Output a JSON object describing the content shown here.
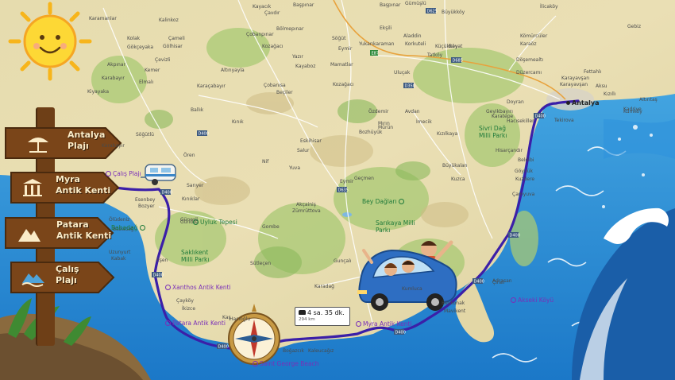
{
  "map": {
    "towns": [
      "Karamanlar",
      "Kalinkoz",
      "Kayacık",
      "Çavdır",
      "Başpınar",
      "Başpınar",
      "Gümüşlü",
      "Büyükköy",
      "İlicaköy",
      "Gebiz",
      "Kolak",
      "Çameli",
      "Gölhisar",
      "Bölmepınar",
      "Söğüt",
      "Yukarıkaraman",
      "Aladdin",
      "Küçükköy",
      "Gökçeyaka",
      "Çevizli",
      "Kozağacı",
      "Yazır",
      "Korkuteli",
      "Bayat",
      "Kömürcüler",
      "Akpınar",
      "Kemer",
      "Eymir",
      "Karaöz",
      "Mamatlar",
      "Tatköy",
      "Ekşili",
      "Karabayır",
      "Elmalı",
      "Altınyayla",
      "Kayaboz",
      "Uluçak",
      "Döşemealtı",
      "Düzercamı",
      "Fettahlı",
      "Karaçabayır",
      "Çobanısa",
      "Beçiler",
      "Kozağacı",
      "Aksu",
      "Karayavşan",
      "Karayavşan",
      "Kızıllı",
      "Kınık",
      "Karabayır",
      "Kiyayaka",
      "Altıntaş",
      "Kumköy",
      "Çobanpınar",
      "Ballık",
      "Özdemir",
      "Avdan",
      "Doyran",
      "Geyikbayırı",
      "Mırın",
      "Mürün",
      "Bozhüyük",
      "Kadriye",
      "Karatepe",
      "Hacısekiller",
      "Nif",
      "İmecik",
      "Kızılkaya",
      "Söğütlü",
      "Eskihisar",
      "Ören",
      "Salur",
      "Hisarçandır",
      "Yuva",
      "Büyükalan",
      "Sarıyer",
      "Eymir",
      "Geçmen",
      "Kuzca",
      "Kuzdere",
      "Çamyuva",
      "Beldibi",
      "Göynük",
      "Esenbey",
      "Bozyer",
      "Kınıklar",
      "Gündüz",
      "Akçainiş",
      "Zümrüttova",
      "Ölüdeniz",
      "Babadağ",
      "Güneşli",
      "Gombe",
      "Uzunyurt",
      "Kabak",
      "Eşen",
      "Sütleçen",
      "Gunçalı",
      "Adrasan",
      "Çayköy",
      "İkizce",
      "Karadağ",
      "Kumluca",
      "Beykonak",
      "Mavikent",
      "Kaş",
      "Hacıoğlu",
      "Boğazcık",
      "Kaleucağız",
      "Çıralı",
      "Tekirova"
    ],
    "pois": [
      {
        "name": "Çalış Plajı",
        "kind": "purple"
      },
      {
        "name": "Xanthos Antik Kenti",
        "kind": "purple"
      },
      {
        "name": "Patara Antik Kenti",
        "kind": "purple"
      },
      {
        "name": "Myra Antik Kenti",
        "kind": "purple"
      },
      {
        "name": "Saint George Beach",
        "kind": "purple"
      },
      {
        "name": "Akseki Köyü",
        "kind": "purple"
      },
      {
        "name": "Uyluk Tepesi",
        "kind": "green"
      },
      {
        "name": "Bey Dağları",
        "kind": "green"
      },
      {
        "name": "Saklıkent Milli Parkı",
        "kind": "green"
      },
      {
        "name": "Sarıkaya Milli Parkı",
        "kind": "green"
      },
      {
        "name": "Sivri Dağ Milli Parkı",
        "kind": "green"
      },
      {
        "name": "Babadağ",
        "kind": "green"
      }
    ],
    "city": "Antalya",
    "road_badges": [
      "D400",
      "D350",
      "D635",
      "D625",
      "D685",
      "E87",
      "D400"
    ],
    "route_info": {
      "time": "4 sa. 35 dk.",
      "distance": "294 km"
    },
    "signpost": [
      {
        "line1": "Antalya",
        "line2": "Plajı",
        "icon": "beach-umbrella-icon"
      },
      {
        "line1": "Myra",
        "line2": "Antik Kenti",
        "icon": "ruins-icon"
      },
      {
        "line1": "Patara",
        "line2": "Antik Kenti",
        "icon": "mountain-icon"
      },
      {
        "line1": "Çalış",
        "line2": "Plajı",
        "icon": "waves-icon"
      }
    ],
    "colors": {
      "route": "#3b1fa8",
      "sea": "#2a8ed6",
      "land": "#e9ddb0",
      "forest": "#9fc46a",
      "sign": "#6e3f17",
      "poi": "#7a2fb8"
    }
  }
}
